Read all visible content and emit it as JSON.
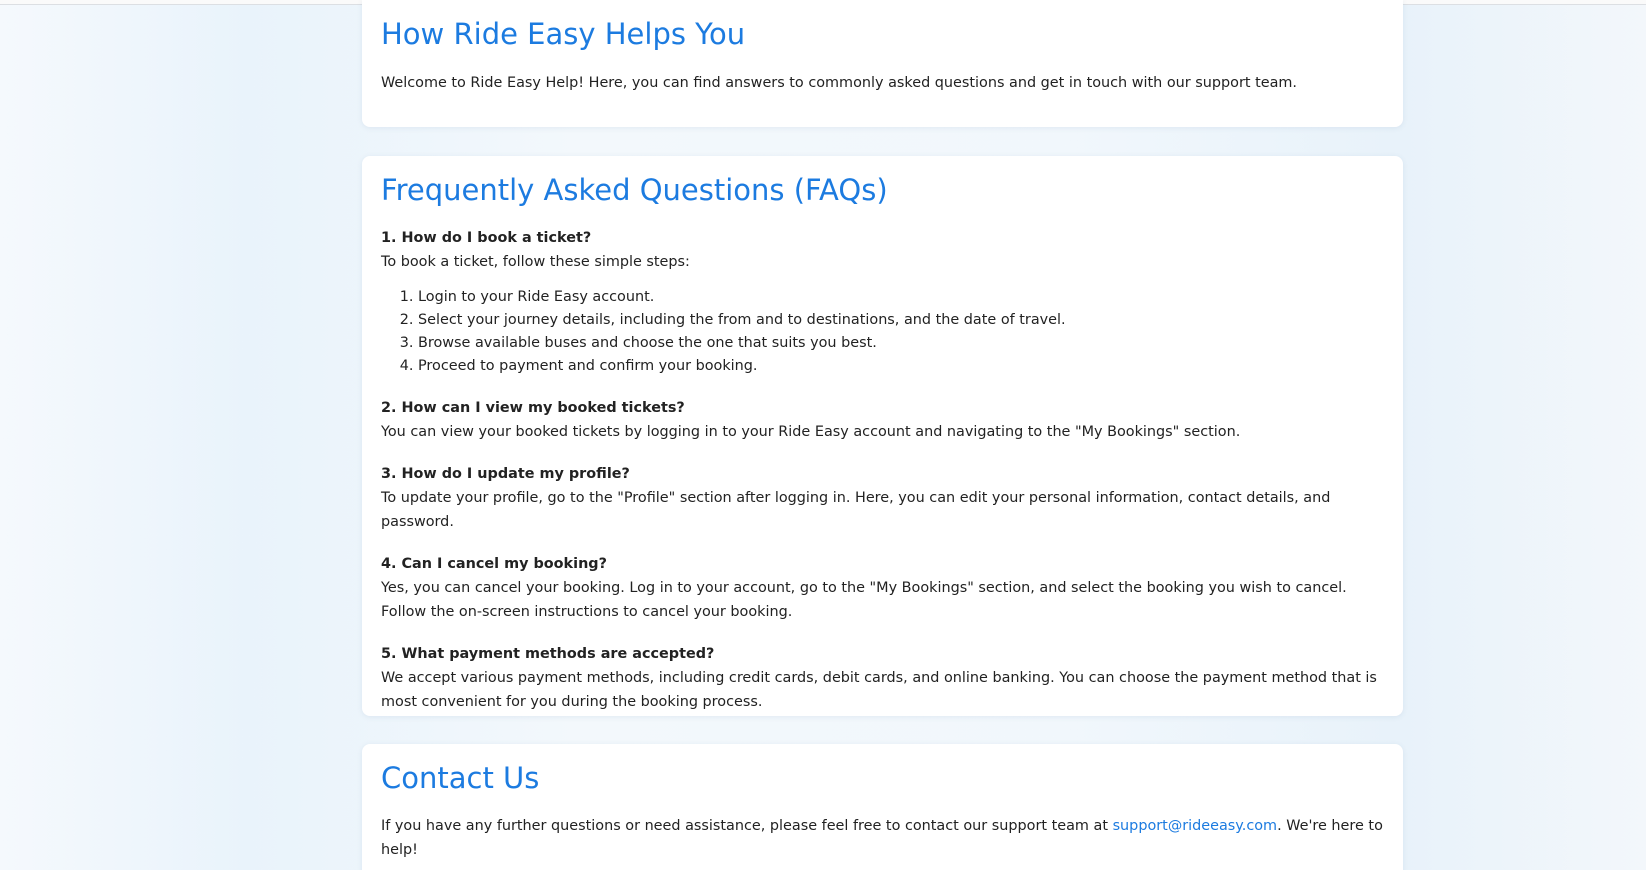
{
  "about": {
    "title": "How Ride Easy Helps You",
    "intro": "Welcome to Ride Easy Help! Here, you can find answers to commonly asked questions and get in touch with our support team."
  },
  "faqs": {
    "title": "Frequently Asked Questions (FAQs)",
    "items": [
      {
        "question": "1. How do I book a ticket?",
        "answer": "To book a ticket, follow these simple steps:",
        "steps": [
          "Login to your Ride Easy account.",
          "Select your journey details, including the from and to destinations, and the date of travel.",
          "Browse available buses and choose the one that suits you best.",
          "Proceed to payment and confirm your booking."
        ]
      },
      {
        "question": "2. How can I view my booked tickets?",
        "answer": "You can view your booked tickets by logging in to your Ride Easy account and navigating to the \"My Bookings\" section."
      },
      {
        "question": "3. How do I update my profile?",
        "answer": "To update your profile, go to the \"Profile\" section after logging in. Here, you can edit your personal information, contact details, and password."
      },
      {
        "question": "4. Can I cancel my booking?",
        "answer": "Yes, you can cancel your booking. Log in to your account, go to the \"My Bookings\" section, and select the booking you wish to cancel. Follow the on-screen instructions to cancel your booking."
      },
      {
        "question": "5. What payment methods are accepted?",
        "answer": "We accept various payment methods, including credit cards, debit cards, and online banking. You can choose the payment method that is most convenient for you during the booking process."
      }
    ]
  },
  "contact": {
    "title": "Contact Us",
    "text_before": "If you have any further questions or need assistance, please feel free to contact our support team at ",
    "email": "support@rideeasy.com",
    "text_after": ". We're here to help!"
  },
  "colors": {
    "accent": "#1c7be0",
    "card_bg": "#ffffff"
  }
}
